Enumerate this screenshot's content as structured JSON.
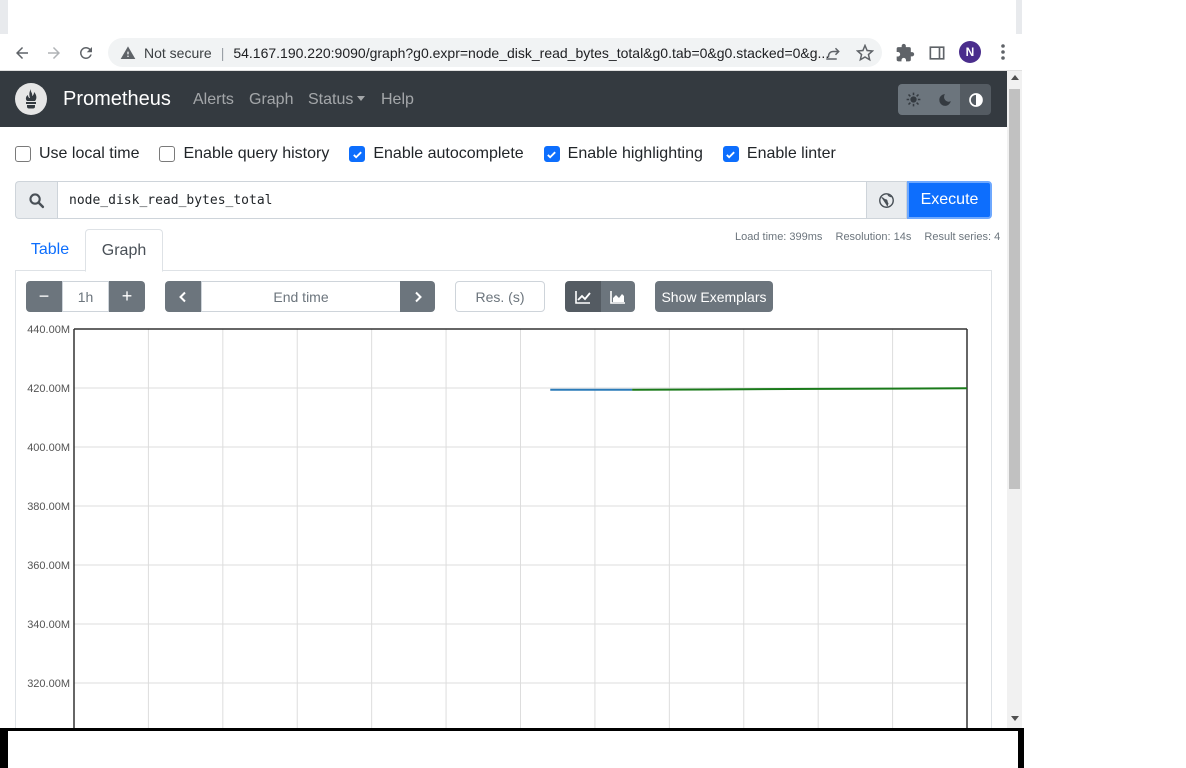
{
  "browser": {
    "security_label": "Not secure",
    "url": "54.167.190.220:9090/graph?g0.expr=node_disk_read_bytes_total&g0.tab=0&g0.stacked=0&g...",
    "profile_initial": "N"
  },
  "navbar": {
    "brand": "Prometheus",
    "links": [
      "Alerts",
      "Graph",
      "Status",
      "Help"
    ]
  },
  "options": {
    "use_local_time": {
      "label": "Use local time",
      "checked": false
    },
    "query_history": {
      "label": "Enable query history",
      "checked": false
    },
    "autocomplete": {
      "label": "Enable autocomplete",
      "checked": true
    },
    "highlighting": {
      "label": "Enable highlighting",
      "checked": true
    },
    "linter": {
      "label": "Enable linter",
      "checked": true
    }
  },
  "query": {
    "expression": "node_disk_read_bytes_total",
    "execute_label": "Execute"
  },
  "stats": {
    "load_time": "Load time: 399ms",
    "resolution": "Resolution: 14s",
    "result_series": "Result series: 4"
  },
  "tabs": {
    "table": "Table",
    "graph": "Graph"
  },
  "controls": {
    "minus": "−",
    "range": "1h",
    "plus": "+",
    "end_time_placeholder": "End time",
    "resolution_placeholder": "Res. (s)",
    "exemplars": "Show Exemplars"
  },
  "chart_data": {
    "type": "line",
    "title": "",
    "xlabel": "",
    "ylabel": "",
    "ylim": [
      300,
      440
    ],
    "y_ticks": [
      "440.00M",
      "420.00M",
      "400.00M",
      "380.00M",
      "360.00M",
      "340.00M",
      "320.00M"
    ],
    "y_tick_values": [
      440,
      420,
      400,
      380,
      360,
      340,
      320
    ],
    "x_range": [
      0,
      12
    ],
    "x_gridlines": 12,
    "grid": true,
    "series": [
      {
        "color": "#2b7bb9",
        "x": [
          6.4,
          7.0,
          7.5
        ],
        "y": [
          419.4,
          419.4,
          419.4
        ]
      },
      {
        "color": "#1a7a1a",
        "x": [
          7.5,
          8.5,
          10.0,
          11.0,
          12.0
        ],
        "y": [
          419.4,
          419.5,
          419.7,
          419.8,
          419.9
        ]
      }
    ]
  },
  "colors": {
    "navbar": "#343a40",
    "primary": "#0d6efd",
    "grey_button": "#6c757d"
  }
}
